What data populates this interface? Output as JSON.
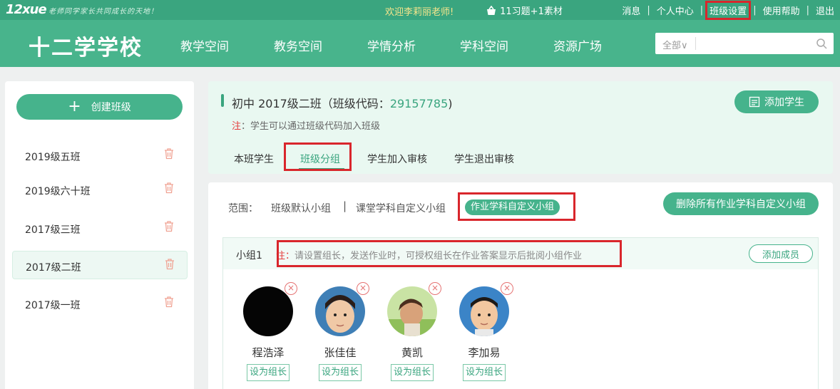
{
  "topbar": {
    "logo": "12xue",
    "slogan": "老师同学家长共同成长的天地！",
    "welcome": "欢迎李莉丽老师!",
    "basket_icon": "basket-icon",
    "basket_text": "11习题+1素材",
    "links": [
      "消息",
      "个人中心",
      "班级设置",
      "使用帮助",
      "退出"
    ]
  },
  "nav": {
    "school": "十二学学校",
    "items": [
      "教学空间",
      "教务空间",
      "学情分析",
      "学科空间",
      "资源广场"
    ],
    "search_scope": "全部",
    "search_placeholder": ""
  },
  "sidebar": {
    "create_label": "创建班级",
    "classes": [
      {
        "name": "2019级五班",
        "active": false
      },
      {
        "name": "2019级六十班",
        "active": false
      },
      {
        "name": "2017级三班",
        "active": false
      },
      {
        "name": "2017级二班",
        "active": true
      },
      {
        "name": "2017级一班",
        "active": false
      }
    ]
  },
  "header": {
    "title_prefix": "初中 2017级二班（班级代码：",
    "class_code": "29157785",
    "title_suffix": ")",
    "note_mark": "注",
    "note_text": "：学生可以通过班级代码加入班级",
    "add_student": "添加学生",
    "tabs": [
      "本班学生",
      "班级分组",
      "学生加入审核",
      "学生退出审核"
    ],
    "active_tab": "班级分组"
  },
  "groups": {
    "scope_label": "范围：",
    "scope_options": [
      "班级默认小组",
      "课堂学科自定义小组",
      "作业学科自定义小组"
    ],
    "scope_separator": "|",
    "active_scope": "作业学科自定义小组",
    "delete_all": "删除所有作业学科自定义小组",
    "group_name": "小组1",
    "note_mark": "注：",
    "note_text": "请设置组长，发送作业时，可授权组长在作业答案显示后批阅小组作业",
    "add_member": "添加成员",
    "set_leader_label": "设为组长",
    "members": [
      {
        "name": "程浩泽"
      },
      {
        "name": "张佳佳"
      },
      {
        "name": "黄凯"
      },
      {
        "name": "李加易"
      }
    ]
  },
  "colors": {
    "topbar": "#3aa57f",
    "navband": "#48b48c",
    "accent": "#46b38c",
    "highlight_box": "#d9262c"
  }
}
